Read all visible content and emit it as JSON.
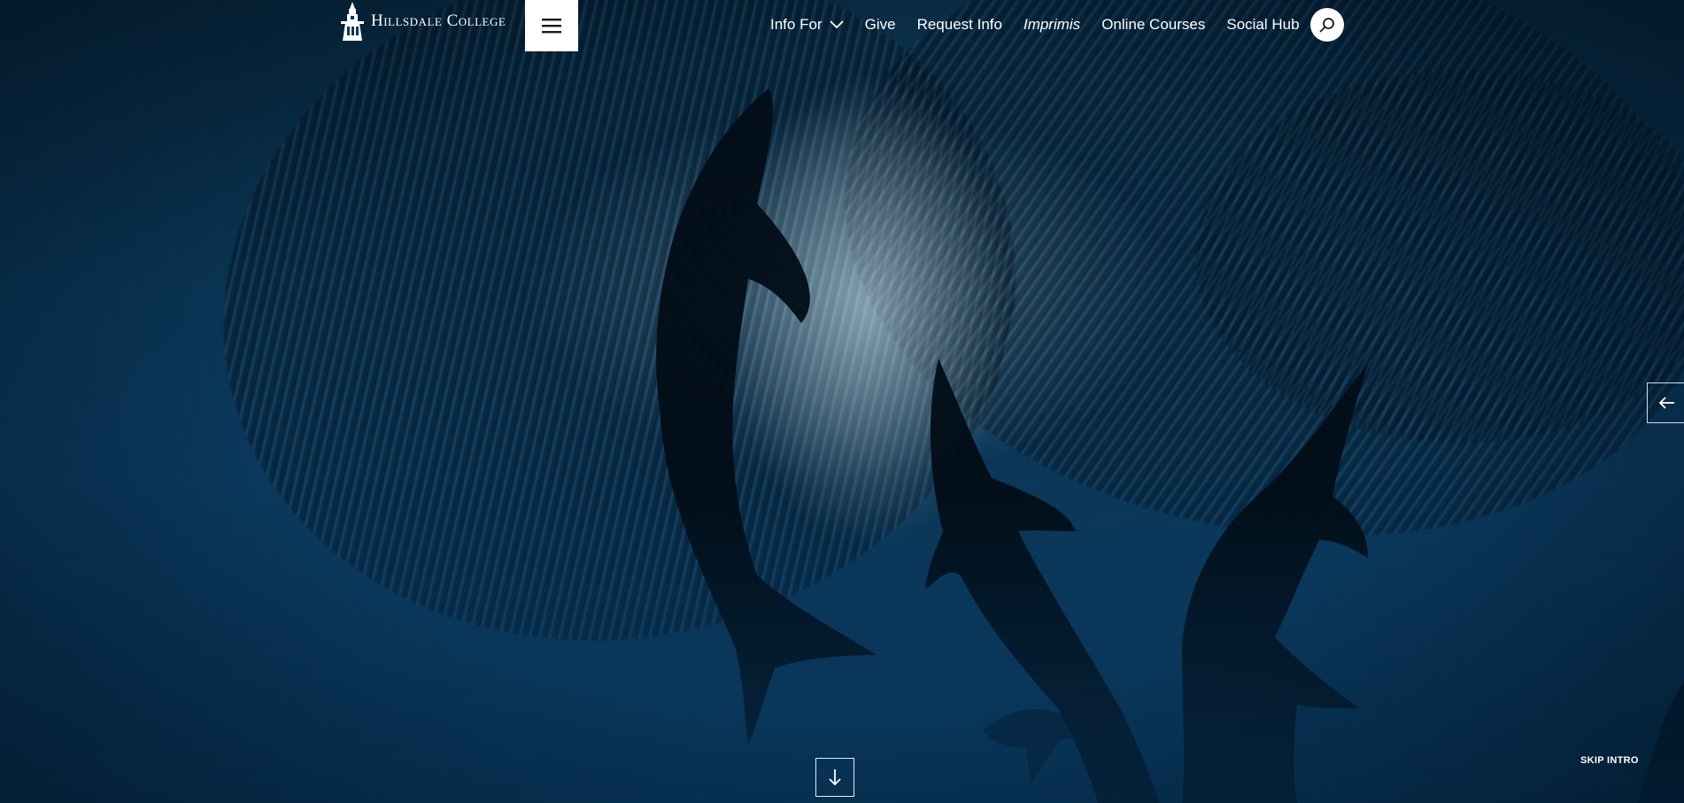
{
  "header": {
    "logo_text": "Hillsdale College",
    "nav": {
      "info_for": "Info For",
      "give": "Give",
      "request_info": "Request Info",
      "imprimis": "Imprimis",
      "online_courses": "Online Courses",
      "social_hub": "Social Hub"
    }
  },
  "hero": {
    "skip_intro": "SKIP INTRO"
  },
  "icons": {
    "menu": "hamburger-menu-icon",
    "dropdown": "chevron-down-icon",
    "search": "search-icon",
    "prev": "arrow-left-icon",
    "scroll": "arrow-down-icon"
  },
  "colors": {
    "ocean_deep": "#08263c",
    "ocean_mid": "#0c3a5e",
    "white": "#ffffff"
  }
}
